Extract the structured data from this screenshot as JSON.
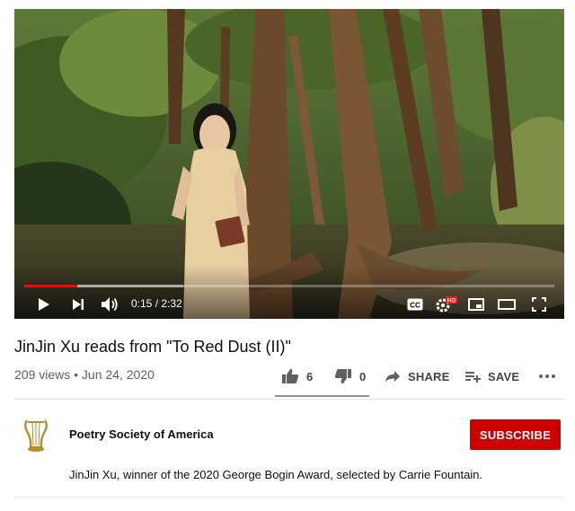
{
  "player": {
    "time_display": "0:15 / 2:32",
    "progress_fraction": 0.1,
    "buffer_fraction": 0.3,
    "controls": [
      "play-icon",
      "next-icon",
      "volume-icon",
      "captions-icon",
      "settings-hd-icon",
      "miniplayer-icon",
      "theater-icon",
      "fullscreen-icon"
    ],
    "hd_badge": "HD",
    "cc_label": "CC"
  },
  "video": {
    "title": "JinJin Xu reads from \"To Red Dust (II)\"",
    "views_date": "209 views • Jun 24, 2020",
    "likes": "6",
    "dislikes": "0",
    "share_label": "SHARE",
    "save_label": "SAVE",
    "more_icon": "more-icon"
  },
  "channel": {
    "name": "Poetry Society of America",
    "subscribe_label": "SUBSCRIBE",
    "accent_color": "#cc0000"
  },
  "description": "JinJin Xu, winner of the 2020 George Bogin Award, selected by Carrie Fountain."
}
